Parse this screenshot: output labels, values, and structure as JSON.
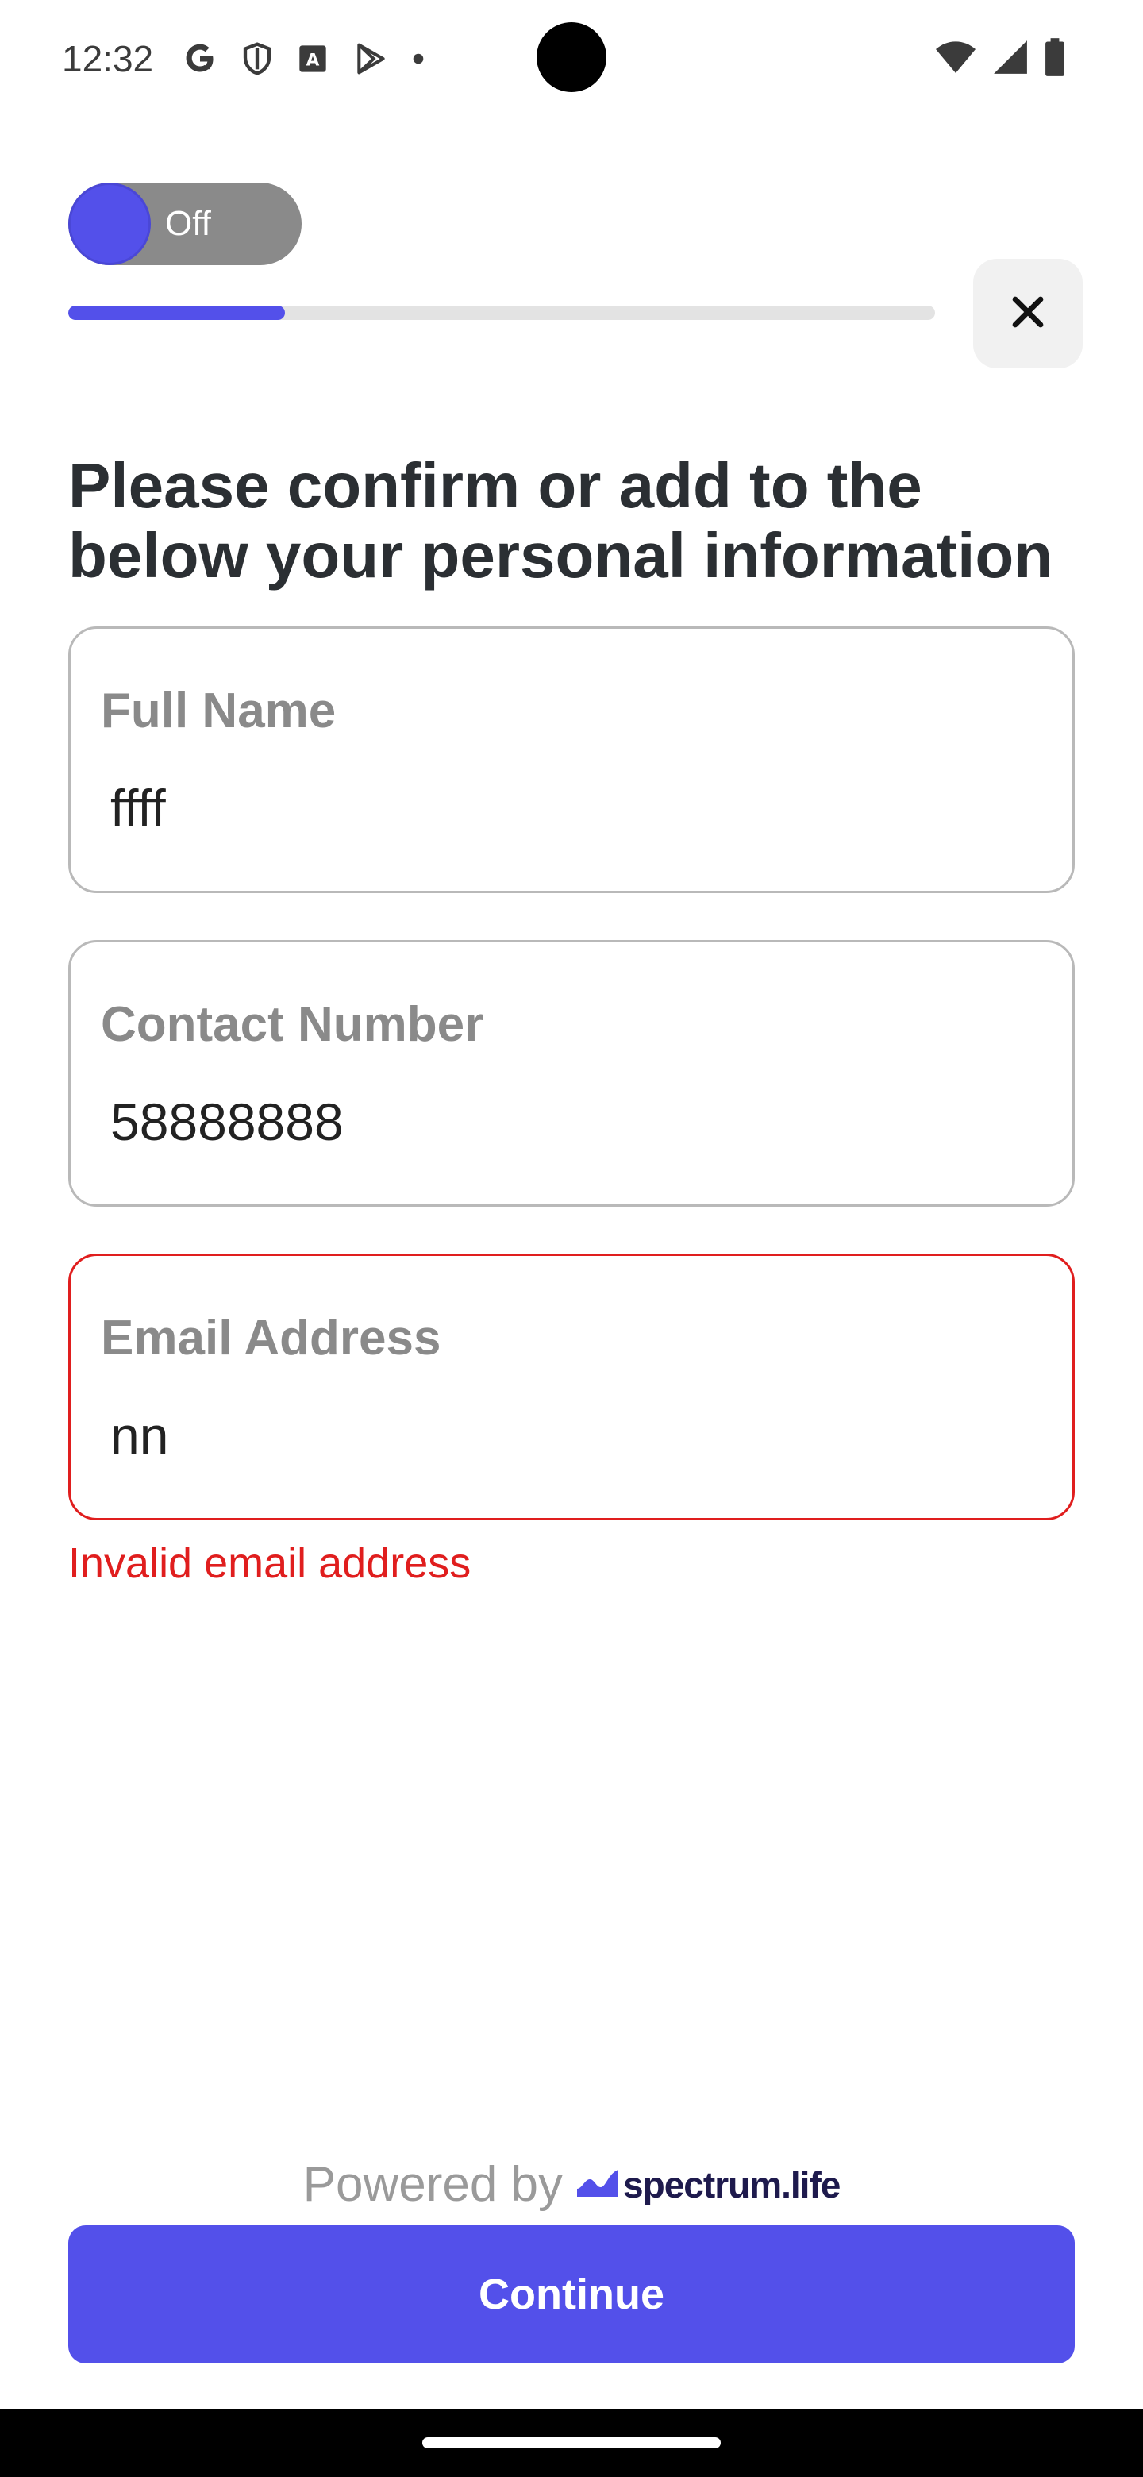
{
  "status_bar": {
    "time": "12:32",
    "left_icons": [
      "google-icon",
      "shield-icon",
      "text-a-icon",
      "play-store-icon",
      "notification-dot-icon"
    ],
    "right_icons": [
      "wifi-icon",
      "signal-icon",
      "battery-icon"
    ]
  },
  "header": {
    "toggle_label": "Off",
    "toggle_on": false,
    "progress_fraction": 0.25,
    "close_icon": "close-icon"
  },
  "main": {
    "title": "Please confirm or add to the below your personal information",
    "fields": [
      {
        "label": "Full Name",
        "value": "ffff"
      },
      {
        "label": "Contact Number",
        "value": "58888888"
      },
      {
        "label": "Email Address",
        "value": "nn"
      }
    ],
    "email_error": "Invalid email address"
  },
  "footer": {
    "powered_by": "Powered by",
    "brand_name": "spectrum.life",
    "continue_label": "Continue"
  },
  "colors": {
    "accent": "#5350ea",
    "error": "#e01e1e",
    "toggle_off": "#8a8a8a"
  }
}
